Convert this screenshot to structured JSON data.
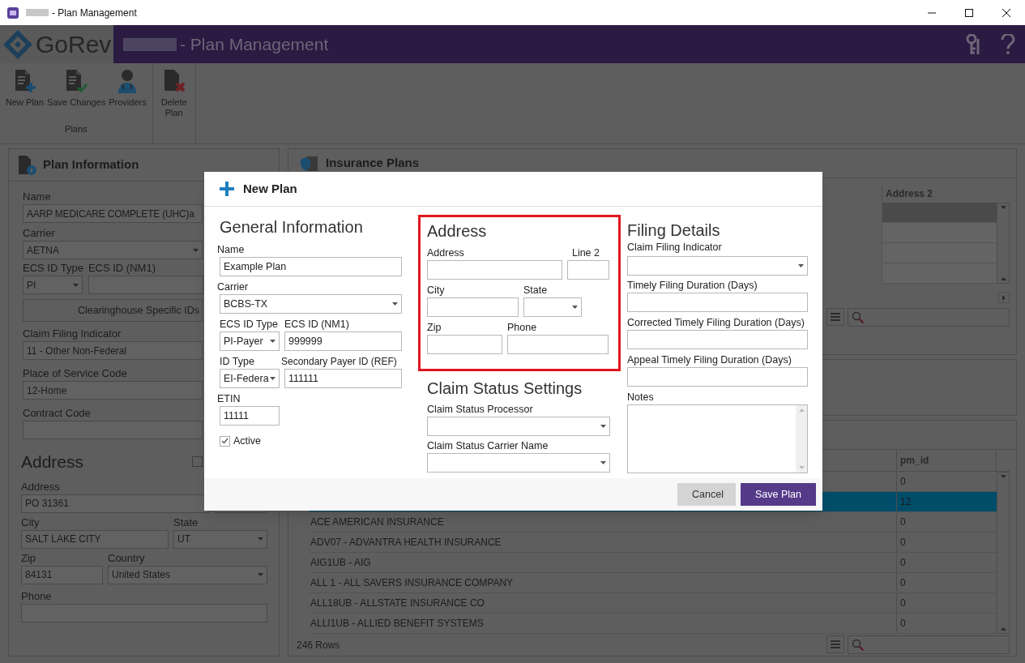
{
  "window": {
    "title": "- Plan Management"
  },
  "header": {
    "logo": "GoRev",
    "title": "- Plan Management"
  },
  "ribbon": {
    "group": "Plans",
    "buttons": [
      {
        "label": "New Plan",
        "kind": "new"
      },
      {
        "label": "Save Changes",
        "kind": "save"
      },
      {
        "label": "Providers",
        "kind": "providers"
      }
    ],
    "extra_buttons": [
      {
        "label": "Delete Plan",
        "kind": "delete"
      }
    ]
  },
  "plan_info": {
    "title": "Plan Information",
    "name_label": "Name",
    "name": "AARP MEDICARE COMPLETE (UHC)a",
    "carrier_label": "Carrier",
    "carrier": "AETNA",
    "ecs_id_type_label": "ECS ID Type",
    "ecs_id_type": "PI",
    "ecs_id_label": "ECS ID (NM1)",
    "clearinghouse_button": "Clearinghouse Specific IDs",
    "claim_filing_label": "Claim Filing Indicator",
    "claim_filing": "11 - Other Non-Federal",
    "pos_label": "Place of Service Code",
    "pos": "12-Home",
    "contract_label": "Contract Code"
  },
  "plan_address": {
    "title": "Address",
    "checked": false,
    "address_label": "Address",
    "address": "PO 31361",
    "city_label": "City",
    "city": "SALT LAKE CITY",
    "state_label": "State",
    "state": "UT",
    "zip_label": "Zip",
    "zip": "84131",
    "country_label": "Country",
    "country": "United States",
    "phone_label": "Phone"
  },
  "insurance_plans": {
    "title": "Insurance Plans",
    "column": "Address 2",
    "rows": [
      {
        "selected": true
      },
      {
        "selected": false
      },
      {
        "selected": false
      },
      {
        "selected": false
      }
    ]
  },
  "carriers_table": {
    "column": "pm_id",
    "footer": "246 Rows",
    "rows": [
      {
        "pm_id": "0",
        "selected": false
      },
      {
        "pm_id": "12",
        "selected": true
      },
      {
        "name": "ACE AMERICAN INSURANCE",
        "pm_id": "0",
        "selected": false
      },
      {
        "name": "ADV07 - ADVANTRA HEALTH INSURANCE",
        "pm_id": "0",
        "selected": false
      },
      {
        "name": "AIG1UB - AIG",
        "pm_id": "0",
        "selected": false
      },
      {
        "name": "ALL 1 - ALL SAVERS INSURANCE COMPANY",
        "pm_id": "0",
        "selected": false
      },
      {
        "name": "ALL18UB - ALLSTATE INSURANCE CO",
        "pm_id": "0",
        "selected": false
      },
      {
        "name": "ALLI1UB - ALLIED BENEFIT SYSTEMS",
        "pm_id": "0",
        "selected": false
      }
    ]
  },
  "dialog": {
    "title": "New Plan",
    "general": {
      "title": "General Information",
      "name_label": "Name",
      "name": "Example Plan",
      "carrier_label": "Carrier",
      "carrier": "BCBS-TX",
      "ecs_id_type_label": "ECS ID Type",
      "ecs_id_type": "PI-Payer",
      "ecs_id_label": "ECS ID (NM1)",
      "ecs_id": "999999",
      "id_type_label": "ID Type",
      "id_type": "EI-Federa",
      "secondary_label": "Secondary Payer ID (REF)",
      "secondary": "111111",
      "etin_label": "ETIN",
      "etin": "11111",
      "active_label": "Active",
      "active": true
    },
    "address": {
      "title": "Address",
      "address_label": "Address",
      "line2_label": "Line 2",
      "city_label": "City",
      "state_label": "State",
      "zip_label": "Zip",
      "phone_label": "Phone"
    },
    "claim_status": {
      "title": "Claim Status Settings",
      "processor_label": "Claim Status Processor",
      "carrier_name_label": "Claim Status Carrier Name"
    },
    "filing": {
      "title": "Filing Details",
      "claim_filing_label": "Claim Filing Indicator",
      "timely_label": "Timely Filing Duration (Days)",
      "corrected_label": "Corrected Timely Filing Duration (Days)",
      "appeal_label": "Appeal Timely Filing Duration (Days)",
      "notes_label": "Notes"
    },
    "buttons": [
      {
        "label": "Cancel",
        "kind": "secondary"
      },
      {
        "label": "Save Plan",
        "kind": "primary"
      }
    ]
  }
}
